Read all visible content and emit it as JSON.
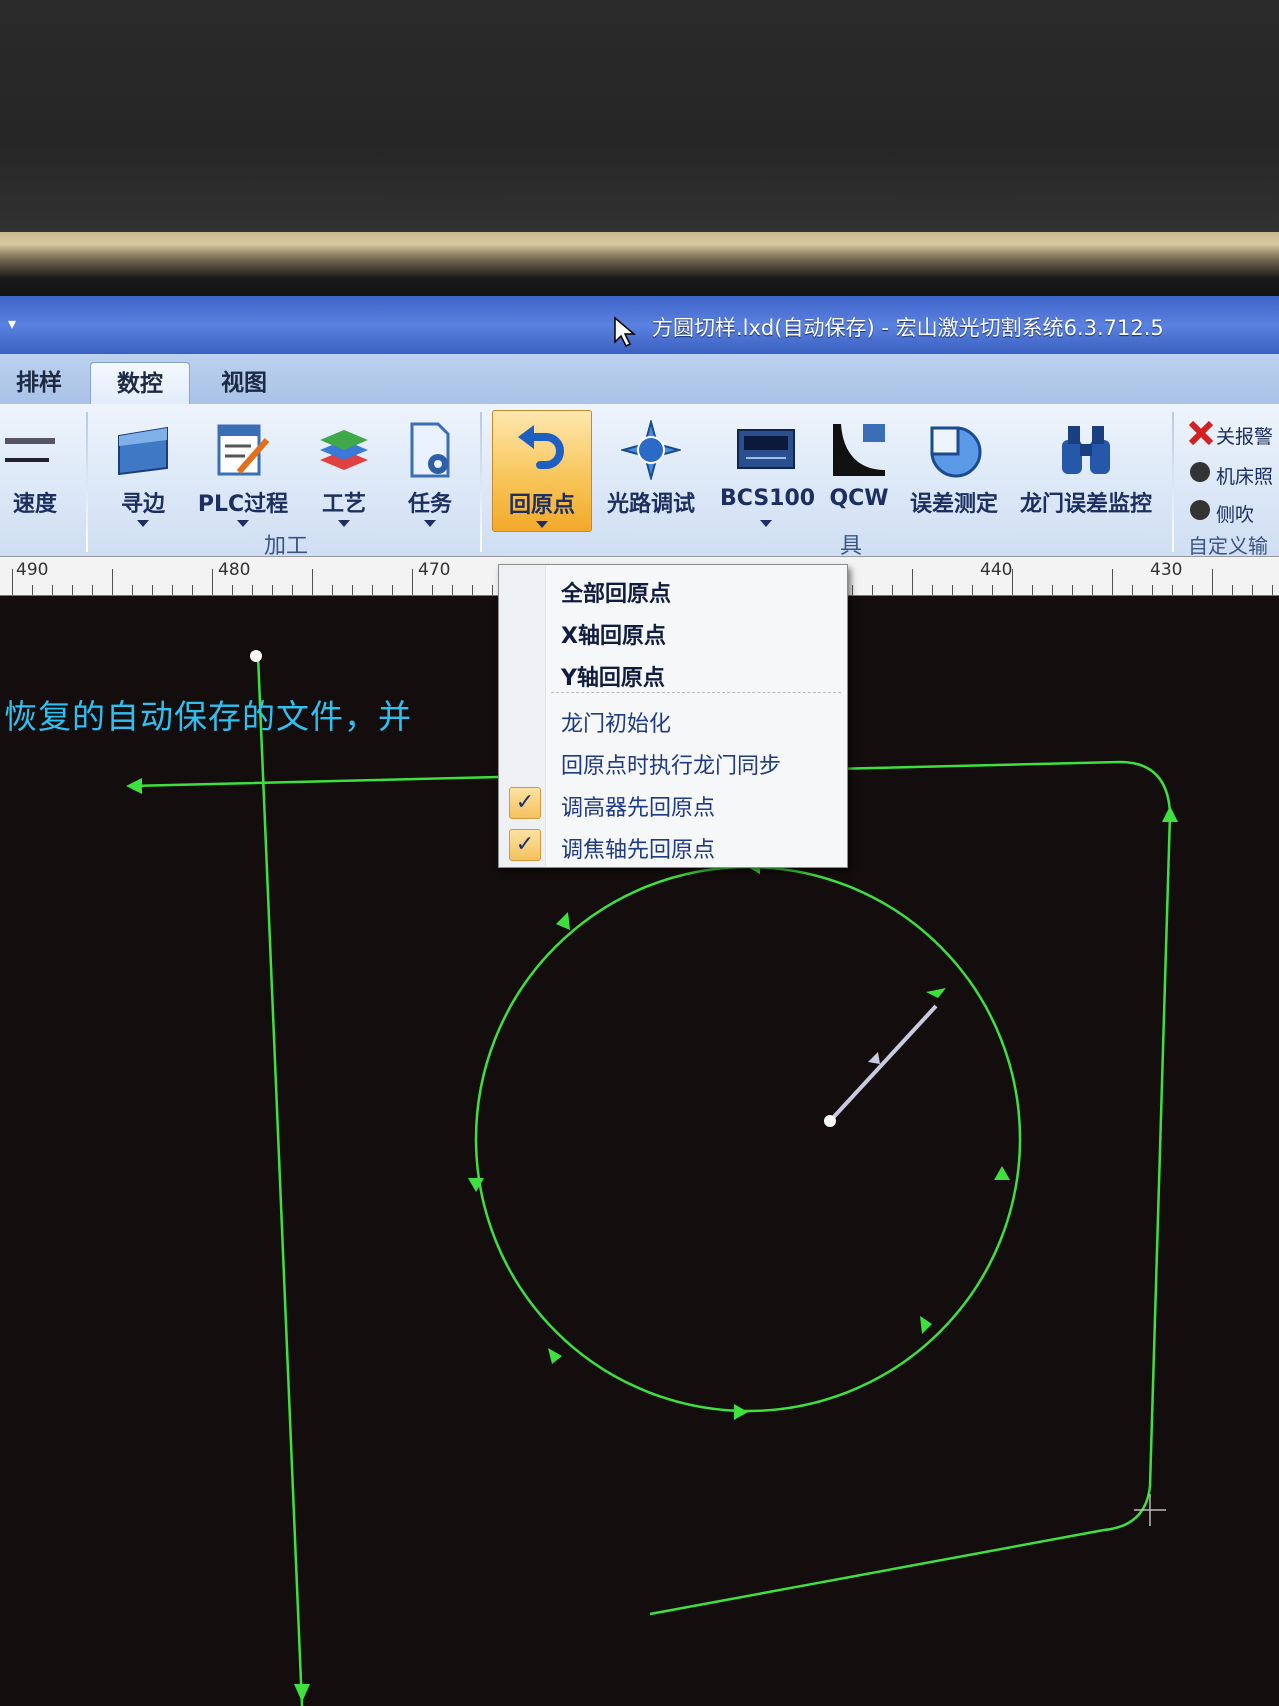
{
  "window": {
    "quick_access": "▾",
    "title": "方圆切样.lxd(自动保存) - 宏山激光切割系统6.3.712.5"
  },
  "tabs": [
    {
      "label": "排样",
      "active": false
    },
    {
      "label": "数控",
      "active": true
    },
    {
      "label": "视图",
      "active": false
    }
  ],
  "ribbon": {
    "speed_label": "速度",
    "buttons": [
      {
        "label": "寻边",
        "icon": "edge-find-icon"
      },
      {
        "label": "PLC过程",
        "icon": "plc-process-icon"
      },
      {
        "label": "工艺",
        "icon": "process-layers-icon"
      },
      {
        "label": "任务",
        "icon": "task-gear-icon"
      },
      {
        "label": "回原点",
        "icon": "return-origin-icon"
      },
      {
        "label": "光路调试",
        "icon": "light-path-icon"
      },
      {
        "label": "BCS100",
        "icon": "bcs100-device-icon"
      },
      {
        "label": "QCW",
        "icon": "qcw-icon"
      },
      {
        "label": "误差测定",
        "icon": "error-measure-icon"
      },
      {
        "label": "龙门误差监控",
        "icon": "binoculars-icon"
      }
    ],
    "group_processing": "加工",
    "group_tools_partial": "具",
    "side_items": [
      "关报警",
      "机床照",
      "侧吹"
    ],
    "group_custom_partial": "自定义输出"
  },
  "ruler": {
    "labels": [
      "490",
      "480",
      "470",
      "440",
      "430"
    ]
  },
  "canvas": {
    "message": "恢复的自动保存的文件，并"
  },
  "menu": {
    "items": [
      {
        "label": "全部回原点",
        "checked": false,
        "bold": true
      },
      {
        "label": "X轴回原点",
        "checked": false,
        "bold": true
      },
      {
        "label": "Y轴回原点",
        "checked": false,
        "bold": true
      },
      {
        "label": "龙门初始化",
        "checked": false,
        "bold": false
      },
      {
        "label": "回原点时执行龙门同步",
        "checked": false,
        "bold": false
      },
      {
        "label": "调高器先回原点",
        "checked": true,
        "bold": false
      },
      {
        "label": "调焦轴先回原点",
        "checked": true,
        "bold": false
      }
    ],
    "check_mark": "✓"
  },
  "colors": {
    "path": "#3ee03e",
    "canvas_bg": "#140d0d",
    "message": "#2fc0f0",
    "accent": "#f5b640"
  }
}
